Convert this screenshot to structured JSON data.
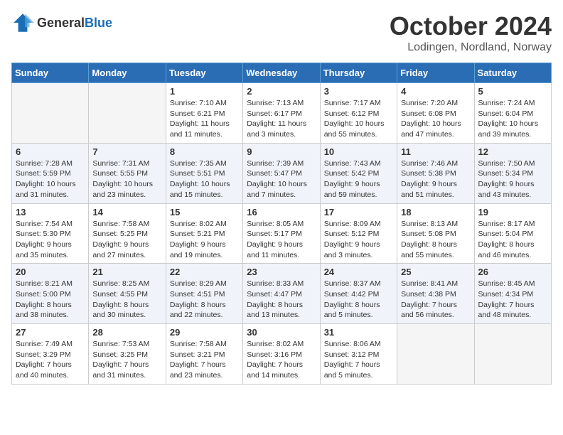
{
  "logo": {
    "general": "General",
    "blue": "Blue"
  },
  "title": "October 2024",
  "location": "Lodingen, Nordland, Norway",
  "weekdays": [
    "Sunday",
    "Monday",
    "Tuesday",
    "Wednesday",
    "Thursday",
    "Friday",
    "Saturday"
  ],
  "weeks": [
    [
      {
        "day": "",
        "info": ""
      },
      {
        "day": "",
        "info": ""
      },
      {
        "day": "1",
        "info": "Sunrise: 7:10 AM\nSunset: 6:21 PM\nDaylight: 11 hours\nand 11 minutes."
      },
      {
        "day": "2",
        "info": "Sunrise: 7:13 AM\nSunset: 6:17 PM\nDaylight: 11 hours\nand 3 minutes."
      },
      {
        "day": "3",
        "info": "Sunrise: 7:17 AM\nSunset: 6:12 PM\nDaylight: 10 hours\nand 55 minutes."
      },
      {
        "day": "4",
        "info": "Sunrise: 7:20 AM\nSunset: 6:08 PM\nDaylight: 10 hours\nand 47 minutes."
      },
      {
        "day": "5",
        "info": "Sunrise: 7:24 AM\nSunset: 6:04 PM\nDaylight: 10 hours\nand 39 minutes."
      }
    ],
    [
      {
        "day": "6",
        "info": "Sunrise: 7:28 AM\nSunset: 5:59 PM\nDaylight: 10 hours\nand 31 minutes."
      },
      {
        "day": "7",
        "info": "Sunrise: 7:31 AM\nSunset: 5:55 PM\nDaylight: 10 hours\nand 23 minutes."
      },
      {
        "day": "8",
        "info": "Sunrise: 7:35 AM\nSunset: 5:51 PM\nDaylight: 10 hours\nand 15 minutes."
      },
      {
        "day": "9",
        "info": "Sunrise: 7:39 AM\nSunset: 5:47 PM\nDaylight: 10 hours\nand 7 minutes."
      },
      {
        "day": "10",
        "info": "Sunrise: 7:43 AM\nSunset: 5:42 PM\nDaylight: 9 hours\nand 59 minutes."
      },
      {
        "day": "11",
        "info": "Sunrise: 7:46 AM\nSunset: 5:38 PM\nDaylight: 9 hours\nand 51 minutes."
      },
      {
        "day": "12",
        "info": "Sunrise: 7:50 AM\nSunset: 5:34 PM\nDaylight: 9 hours\nand 43 minutes."
      }
    ],
    [
      {
        "day": "13",
        "info": "Sunrise: 7:54 AM\nSunset: 5:30 PM\nDaylight: 9 hours\nand 35 minutes."
      },
      {
        "day": "14",
        "info": "Sunrise: 7:58 AM\nSunset: 5:25 PM\nDaylight: 9 hours\nand 27 minutes."
      },
      {
        "day": "15",
        "info": "Sunrise: 8:02 AM\nSunset: 5:21 PM\nDaylight: 9 hours\nand 19 minutes."
      },
      {
        "day": "16",
        "info": "Sunrise: 8:05 AM\nSunset: 5:17 PM\nDaylight: 9 hours\nand 11 minutes."
      },
      {
        "day": "17",
        "info": "Sunrise: 8:09 AM\nSunset: 5:12 PM\nDaylight: 9 hours\nand 3 minutes."
      },
      {
        "day": "18",
        "info": "Sunrise: 8:13 AM\nSunset: 5:08 PM\nDaylight: 8 hours\nand 55 minutes."
      },
      {
        "day": "19",
        "info": "Sunrise: 8:17 AM\nSunset: 5:04 PM\nDaylight: 8 hours\nand 46 minutes."
      }
    ],
    [
      {
        "day": "20",
        "info": "Sunrise: 8:21 AM\nSunset: 5:00 PM\nDaylight: 8 hours\nand 38 minutes."
      },
      {
        "day": "21",
        "info": "Sunrise: 8:25 AM\nSunset: 4:55 PM\nDaylight: 8 hours\nand 30 minutes."
      },
      {
        "day": "22",
        "info": "Sunrise: 8:29 AM\nSunset: 4:51 PM\nDaylight: 8 hours\nand 22 minutes."
      },
      {
        "day": "23",
        "info": "Sunrise: 8:33 AM\nSunset: 4:47 PM\nDaylight: 8 hours\nand 13 minutes."
      },
      {
        "day": "24",
        "info": "Sunrise: 8:37 AM\nSunset: 4:42 PM\nDaylight: 8 hours\nand 5 minutes."
      },
      {
        "day": "25",
        "info": "Sunrise: 8:41 AM\nSunset: 4:38 PM\nDaylight: 7 hours\nand 56 minutes."
      },
      {
        "day": "26",
        "info": "Sunrise: 8:45 AM\nSunset: 4:34 PM\nDaylight: 7 hours\nand 48 minutes."
      }
    ],
    [
      {
        "day": "27",
        "info": "Sunrise: 7:49 AM\nSunset: 3:29 PM\nDaylight: 7 hours\nand 40 minutes."
      },
      {
        "day": "28",
        "info": "Sunrise: 7:53 AM\nSunset: 3:25 PM\nDaylight: 7 hours\nand 31 minutes."
      },
      {
        "day": "29",
        "info": "Sunrise: 7:58 AM\nSunset: 3:21 PM\nDaylight: 7 hours\nand 23 minutes."
      },
      {
        "day": "30",
        "info": "Sunrise: 8:02 AM\nSunset: 3:16 PM\nDaylight: 7 hours\nand 14 minutes."
      },
      {
        "day": "31",
        "info": "Sunrise: 8:06 AM\nSunset: 3:12 PM\nDaylight: 7 hours\nand 5 minutes."
      },
      {
        "day": "",
        "info": ""
      },
      {
        "day": "",
        "info": ""
      }
    ]
  ]
}
